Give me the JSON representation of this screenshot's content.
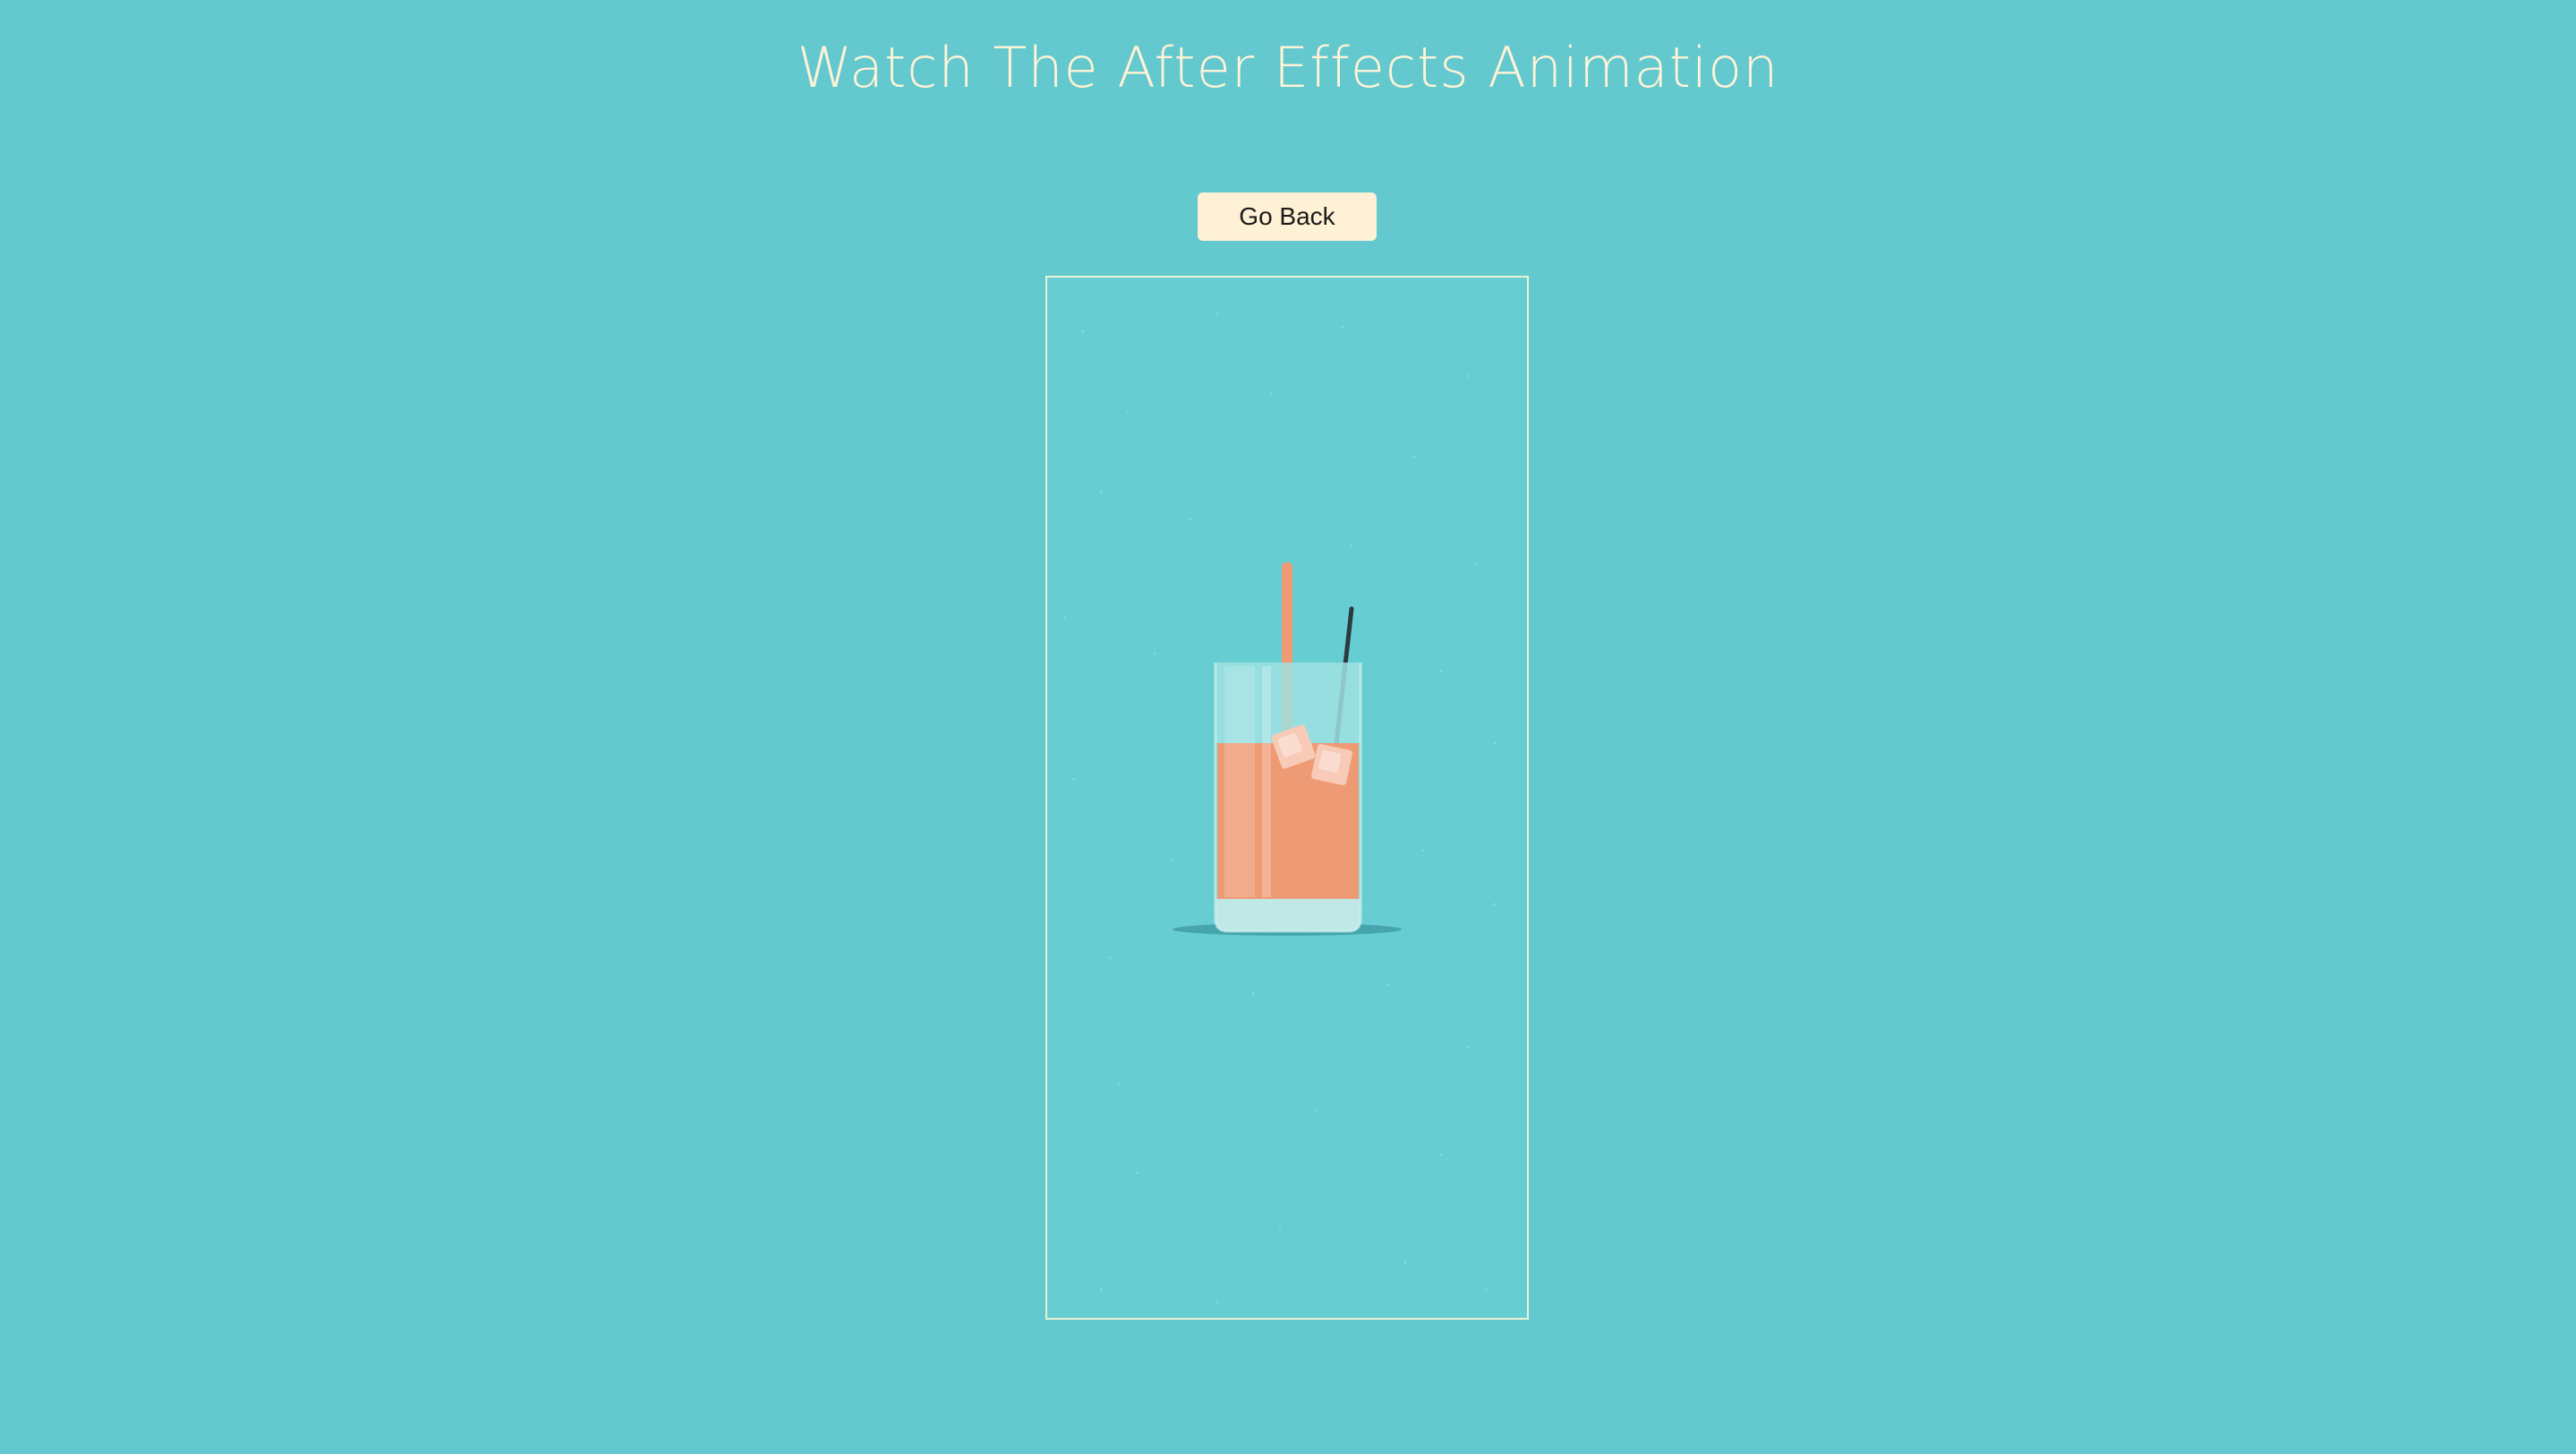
{
  "page": {
    "title": "Watch The After Effects Animation",
    "background_color": "#63c9cf"
  },
  "controls": {
    "back_label": "Go Back"
  },
  "animation": {
    "subject": "glass-of-iced-drink",
    "colors": {
      "stage": "#66ced3",
      "drink": "#ee9a74",
      "glass": "#bfe8e6",
      "straw_orange": "#ee9a74",
      "straw_dark": "#2d3b3e",
      "ice": "#f6c6b1",
      "shadow": "#3f9aa3"
    }
  }
}
